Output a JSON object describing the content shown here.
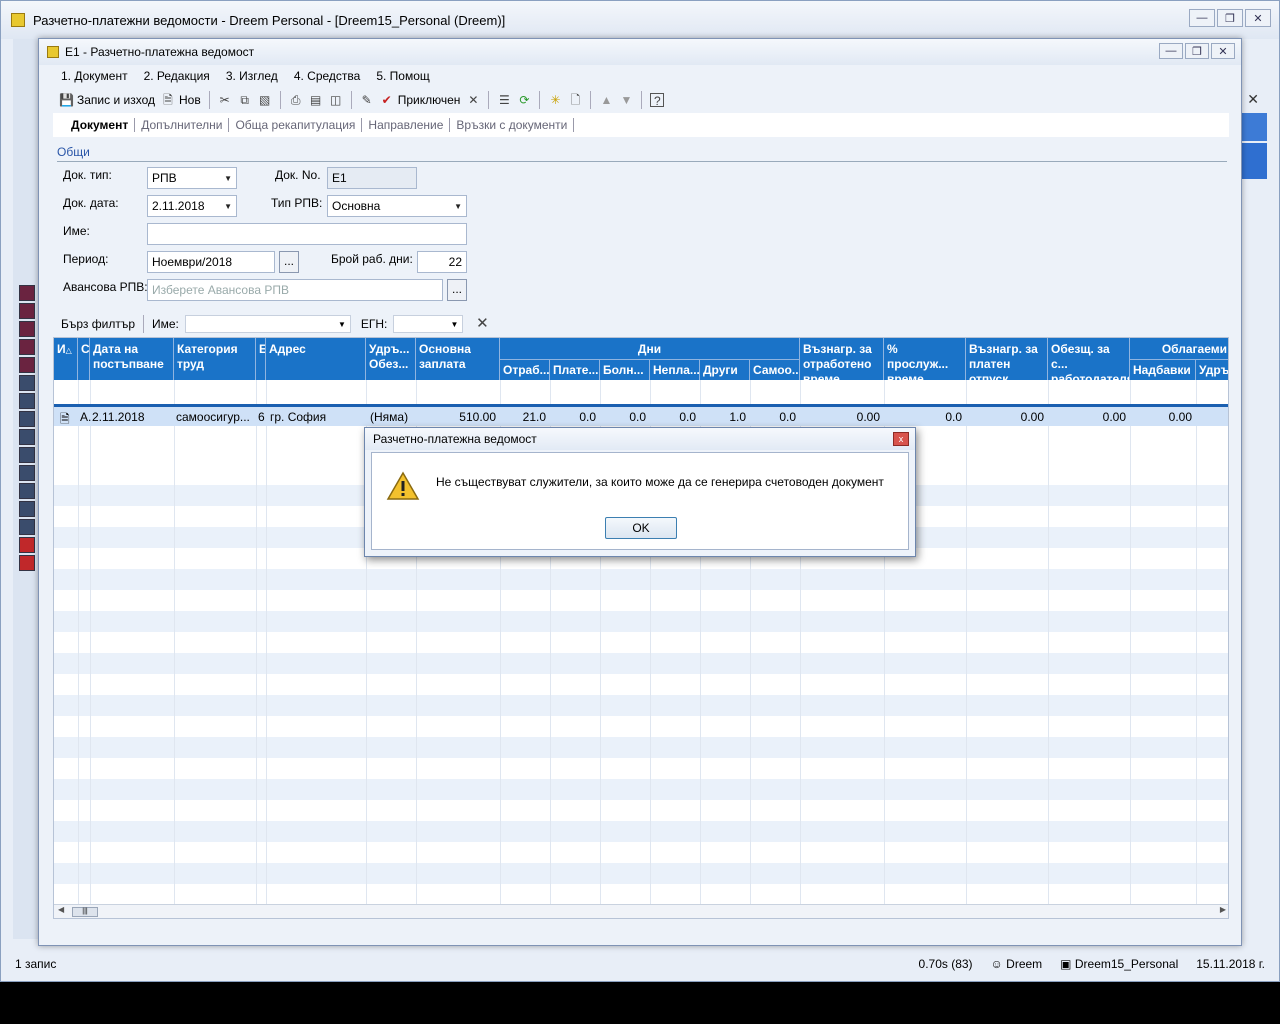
{
  "outer": {
    "title": "Разчетно-платежни ведомости - Dreem Personal - [Dreem15_Personal (Dreem)]",
    "status": {
      "records": "1 запис",
      "timing": "0.70s (83)",
      "user": "Dreem",
      "database": "Dreem15_Personal",
      "date": "15.11.2018 г."
    }
  },
  "inner": {
    "title": "E1 - Разчетно-платежна ведомост",
    "menu": [
      "1. Документ",
      "2. Редакция",
      "3. Изглед",
      "4. Средства",
      "5. Помощ"
    ],
    "toolbar": {
      "save_exit": "Запис и изход",
      "new": "Нов",
      "complete": "Приключен"
    },
    "tabs": [
      "Документ",
      "Допълнителни",
      "Обща рекапитулация",
      "Направление",
      "Връзки с документи"
    ],
    "form": {
      "section": "Общи",
      "doc_type_label": "Док. тип:",
      "doc_type_value": "РПВ",
      "doc_no_label": "Док. No.",
      "doc_no_value": "E1",
      "doc_date_label": "Док. дата:",
      "doc_date_value": "2.11.2018",
      "rpv_type_label": "Тип РПВ:",
      "rpv_type_value": "Основна",
      "name_label": "Име:",
      "name_value": "",
      "period_label": "Период:",
      "period_value": "Ноември/2018",
      "workdays_label": "Брой раб. дни:",
      "workdays_value": "22",
      "advance_label": "Авансова РПВ:",
      "advance_placeholder": "Изберете Авансова РПВ",
      "dots": "..."
    },
    "filter": {
      "quick": "Бърз филтър",
      "name_label": "Име:",
      "egn_label": "ЕГН:"
    },
    "grid": {
      "headers": {
        "col0": "И",
        "col1": "С.",
        "col2": "Дата на постъпване",
        "col3": "Категория труд",
        "col4": "Е",
        "col5": "Адрес",
        "col6": "Удръ... Обез...",
        "col7": "Основна заплата",
        "days": "Дни",
        "days_sub": [
          "Отраб...",
          "Плате...",
          "Болн...",
          "Непла...",
          "Други",
          "Самоо..."
        ],
        "col14": "Възнагр. за отработено време",
        "col15": "% прослуж... време",
        "col16": "Възнагр. за платен отпуск",
        "col17": "Обезщ. за с... работодателя",
        "taxable": "Облагаеми",
        "taxable_sub": [
          "Надбавки",
          "Удръ"
        ]
      },
      "row": {
        "c1": "А.",
        "date": "2.11.2018",
        "category": "самоосигур...",
        "e": "6",
        "address": "гр. София",
        "deduct": "(Няма)",
        "salary": "510.00",
        "worked": "21.0",
        "paid": "0.0",
        "sick": "0.0",
        "unpaid": "0.0",
        "other": "1.0",
        "self": "0.0",
        "pay_worked": "0.00",
        "pct": "0.0",
        "pay_leave": "0.00",
        "compensation": "0.00",
        "bonuses": "0.00"
      }
    }
  },
  "dialog": {
    "title": "Разчетно-платежна ведомост",
    "message": "Не съществуват служители, за които може да се генерира счетоводен документ",
    "ok": "OK",
    "close": "x"
  }
}
